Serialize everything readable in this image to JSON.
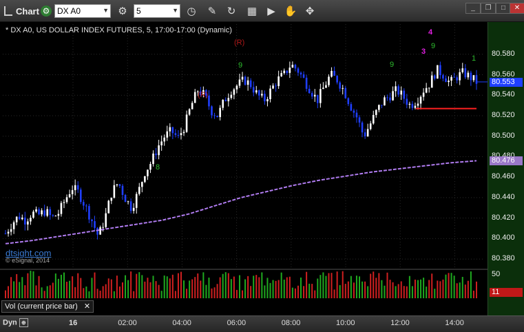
{
  "toolbar": {
    "chart_label": "Chart",
    "symbol": "DX A0",
    "interval": "5",
    "icons": [
      "clock-icon",
      "pencil-icon",
      "refresh-icon",
      "ticker-icon",
      "play-icon",
      "cursor-icon"
    ]
  },
  "chart_title": "* DX A0, US DOLLAR INDEX FUTURES, 5, 17:00-17:00 (Dynamic)",
  "watermark": "dtsight.com",
  "copyright": "© eSignal, 2014",
  "volume_label": "Vol (current price bar)",
  "dyn_label": "Dyn",
  "price_badges": {
    "last": "80.553",
    "ma": "80.476",
    "vol_last": "11"
  },
  "colors": {
    "up_candle": "#ffffff",
    "down_candle": "#1f3fff",
    "ma_line": "#b07cf0",
    "resistance": "#ff2020",
    "vol_up": "#1faa1f",
    "vol_down": "#d02020",
    "axis_bg": "#0b2f0b"
  },
  "chart_data": [
    {
      "type": "candlestick",
      "title": "* DX A0, US DOLLAR INDEX FUTURES, 5, 17:00-17:00 (Dynamic)",
      "x_ticks": [
        "16",
        "02:00",
        "04:00",
        "06:00",
        "08:00",
        "10:00",
        "12:00",
        "14:00"
      ],
      "y_ticks": [
        "80.580",
        "80.560",
        "80.540",
        "80.520",
        "80.500",
        "80.480",
        "80.460",
        "80.440",
        "80.420",
        "80.400",
        "80.380"
      ],
      "ylim": [
        80.372,
        80.596
      ],
      "last_price": 80.553,
      "ma_value": 80.476,
      "close_path": [
        80.405,
        80.415,
        80.422,
        80.418,
        80.425,
        80.423,
        80.427,
        80.42,
        80.425,
        80.438,
        80.45,
        80.445,
        80.432,
        80.418,
        80.402,
        80.42,
        80.445,
        80.455,
        80.44,
        80.43,
        80.445,
        80.465,
        80.475,
        80.49,
        80.5,
        80.505,
        80.498,
        80.51,
        80.53,
        80.545,
        80.54,
        80.525,
        80.52,
        80.535,
        80.545,
        80.55,
        80.555,
        80.55,
        80.54,
        80.535,
        80.545,
        80.555,
        80.56,
        80.57,
        80.565,
        80.555,
        80.545,
        80.535,
        80.548,
        80.56,
        80.555,
        80.545,
        80.53,
        80.518,
        80.5,
        80.512,
        80.525,
        80.535,
        80.54,
        80.545,
        80.538,
        80.53,
        80.535,
        80.545,
        80.552,
        80.565,
        80.56,
        80.552,
        80.558,
        80.562,
        80.558,
        80.553
      ],
      "ma_path": [
        80.395,
        80.398,
        80.402,
        80.406,
        80.41,
        80.414,
        80.418,
        80.424,
        80.432,
        80.44,
        80.446,
        80.452,
        80.457,
        80.461,
        80.465,
        80.468,
        80.471,
        80.474,
        80.476
      ],
      "resistance_level": 80.527,
      "annotations": [
        "(R)",
        "(R)",
        "4",
        "3",
        "9",
        "9",
        "9",
        "8",
        "1"
      ]
    },
    {
      "type": "bar",
      "title": "Vol (current price bar)",
      "y_ticks": [
        "50"
      ],
      "last_value": 11
    }
  ]
}
